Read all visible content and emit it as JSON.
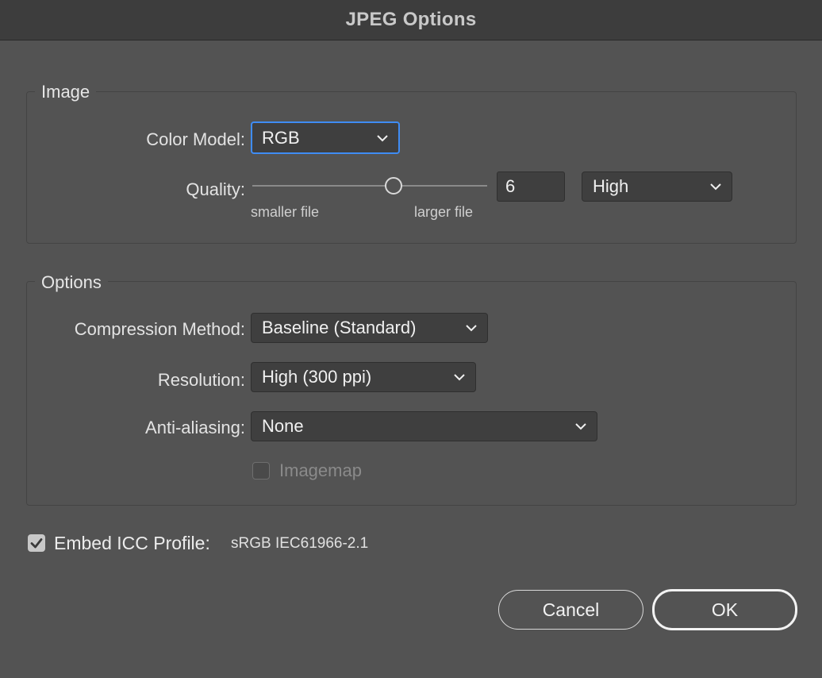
{
  "dialog": {
    "title": "JPEG Options"
  },
  "image_group": {
    "label": "Image",
    "color_model_label": "Color Model:",
    "color_model_value": "RGB",
    "quality_label": "Quality:",
    "quality_slider_fraction": 0.6,
    "smaller_file_label": "smaller file",
    "larger_file_label": "larger file",
    "quality_value": "6",
    "quality_preset": "High"
  },
  "options_group": {
    "label": "Options",
    "compression_label": "Compression Method:",
    "compression_value": "Baseline (Standard)",
    "resolution_label": "Resolution:",
    "resolution_value": "High (300 ppi)",
    "antialiasing_label": "Anti-aliasing:",
    "antialiasing_value": "None",
    "imagemap_label": "Imagemap",
    "imagemap_checked": false
  },
  "icc": {
    "label": "Embed ICC Profile:",
    "profile": "sRGB IEC61966-2.1",
    "checked": true
  },
  "buttons": {
    "cancel": "Cancel",
    "ok": "OK"
  },
  "colors": {
    "background": "#535353",
    "focus_ring": "#3f8cf4",
    "checkbox_fill": "#c8c8c8"
  }
}
